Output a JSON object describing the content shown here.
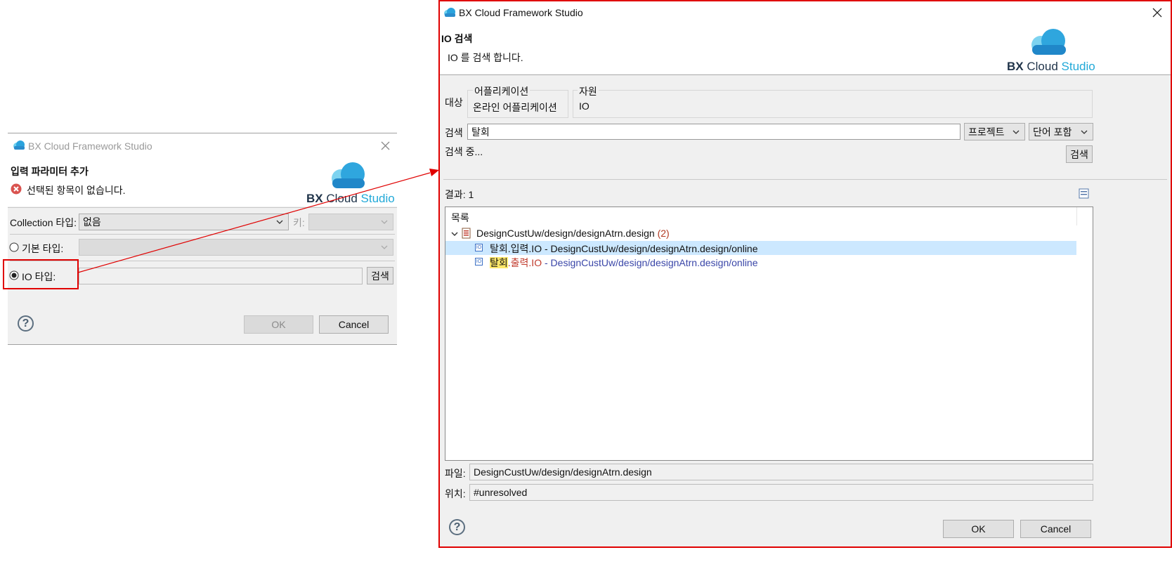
{
  "colors": {
    "dialog_bg": "#f0f0f0",
    "accent_red": "#e00000",
    "selected_row": "#cce8ff",
    "path_blue": "#3a46a8",
    "count_red": "#b23a22",
    "match_highlight": "#ffe96b",
    "logo_dark": "#1f3349",
    "logo_cyan": "#22a9d8"
  },
  "left_dialog": {
    "title": "BX Cloud Framework Studio",
    "heading": "입력 파라미터 추가",
    "error_message": "선택된 항목이 없습니다.",
    "logo": {
      "bx": "BX",
      "cloud": "Cloud",
      "studio": "Studio"
    },
    "collection_type_label": "Collection 타입:",
    "collection_type_value": "없음",
    "key_label": "키:",
    "basic_type_label": "기본 타입:",
    "io_type_label": "IO 타입:",
    "io_type_value": "",
    "search_button": "검색",
    "ok_button": "OK",
    "cancel_button": "Cancel",
    "help_icon": "?"
  },
  "right_dialog": {
    "title": "BX Cloud Framework Studio",
    "heading": "IO 검색",
    "description": "IO 를 검색 합니다.",
    "logo": {
      "bx": "BX",
      "cloud": "Cloud",
      "studio": "Studio"
    },
    "target_label": "대상",
    "application_group_label": "어플리케이션",
    "application_value": "온라인 어플리케이션",
    "resource_group_label": "자원",
    "resource_value": "IO",
    "search_label": "검색",
    "search_value": "탈회",
    "scope_select": "프로젝트",
    "match_select": "단어 포함",
    "status_text": "검색 중...",
    "search_button": "검색",
    "result_label": "결과:",
    "result_count": "1",
    "list_header": "목록",
    "tree": {
      "parent_label": "DesignCustUw/design/designAtrn.design",
      "parent_count": "(2)",
      "items": [
        {
          "icon": "IO",
          "match": "탈회",
          "name_rest": ".입력.IO",
          "separator": " - ",
          "path": "DesignCustUw/design/designAtrn.design/online"
        },
        {
          "icon": "IO",
          "match": "탈회",
          "name_rest": ".출력.IO",
          "separator": " - ",
          "path": "DesignCustUw/design/designAtrn.design/online"
        }
      ]
    },
    "file_label": "파일:",
    "file_value": "DesignCustUw/design/designAtrn.design",
    "location_label": "위치:",
    "location_value": "#unresolved",
    "ok_button": "OK",
    "cancel_button": "Cancel",
    "help_icon": "?"
  }
}
